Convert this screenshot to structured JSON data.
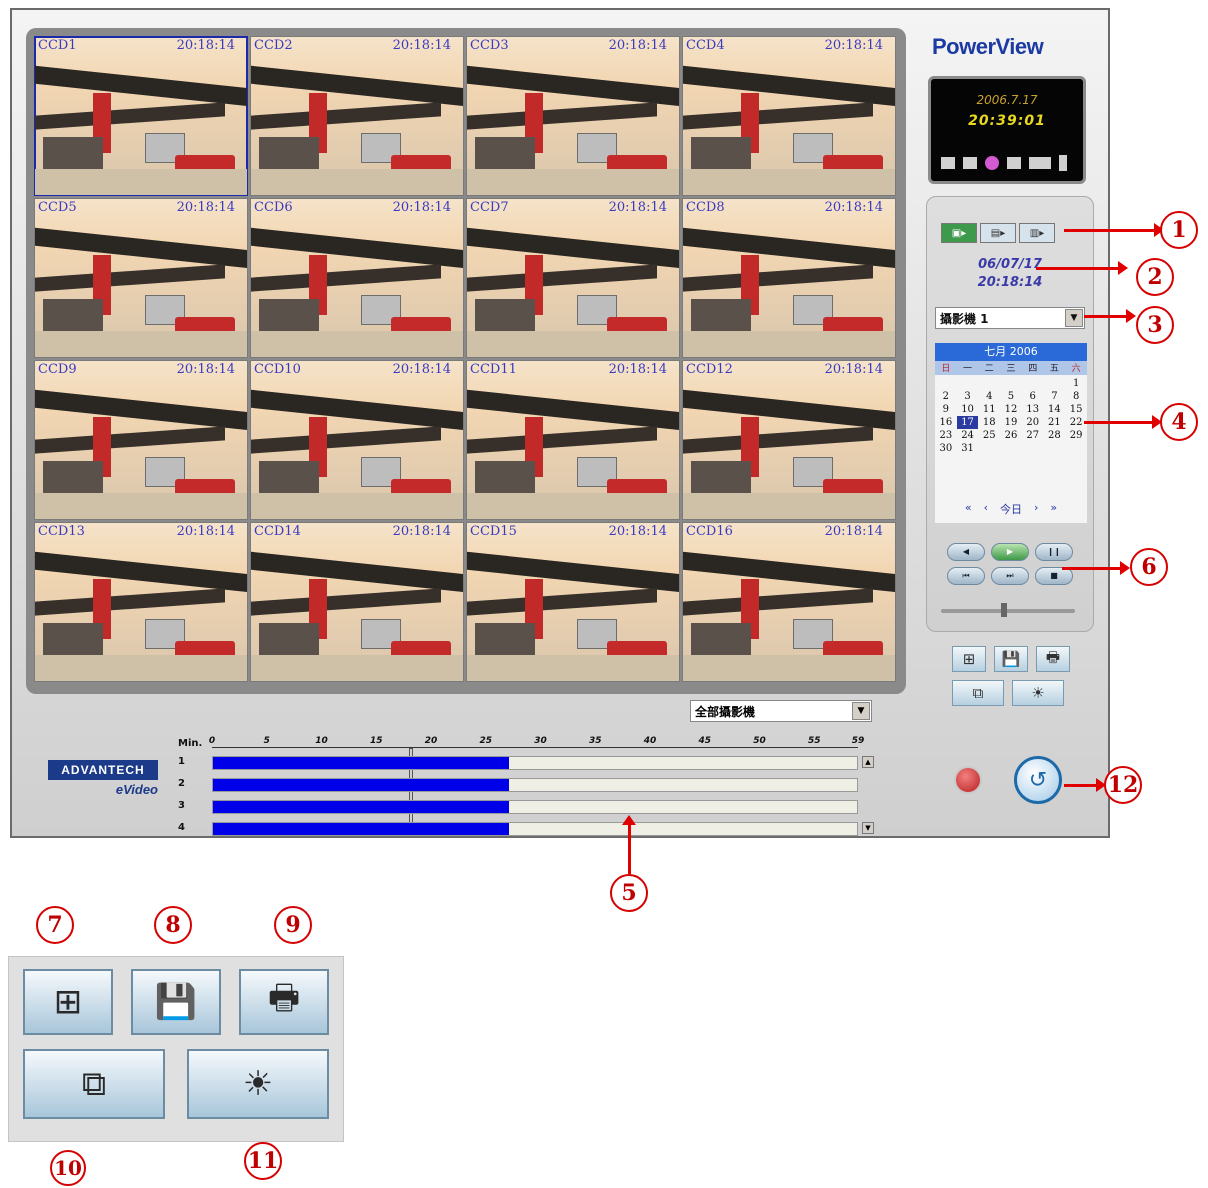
{
  "cameras": [
    {
      "label": "CCD1",
      "time": "20:18:14"
    },
    {
      "label": "CCD2",
      "time": "20:18:14"
    },
    {
      "label": "CCD3",
      "time": "20:18:14"
    },
    {
      "label": "CCD4",
      "time": "20:18:14"
    },
    {
      "label": "CCD5",
      "time": "20:18:14"
    },
    {
      "label": "CCD6",
      "time": "20:18:14"
    },
    {
      "label": "CCD7",
      "time": "20:18:14"
    },
    {
      "label": "CCD8",
      "time": "20:18:14"
    },
    {
      "label": "CCD9",
      "time": "20:18:14"
    },
    {
      "label": "CCD10",
      "time": "20:18:14"
    },
    {
      "label": "CCD11",
      "time": "20:18:14"
    },
    {
      "label": "CCD12",
      "time": "20:18:14"
    },
    {
      "label": "CCD13",
      "time": "20:18:14"
    },
    {
      "label": "CCD14",
      "time": "20:18:14"
    },
    {
      "label": "CCD15",
      "time": "20:18:14"
    },
    {
      "label": "CCD16",
      "time": "20:18:14"
    }
  ],
  "brand": {
    "name": "PowerView"
  },
  "clock": {
    "date": "2006.7.17",
    "time": "20:39:01"
  },
  "playback": {
    "date": "06/07/17",
    "time": "20:18:14"
  },
  "camera_select": {
    "value": "攝影機 1"
  },
  "calendar": {
    "month": "七月 2006",
    "weekdays": [
      "日",
      "一",
      "二",
      "三",
      "四",
      "五",
      "六"
    ],
    "days": [
      "",
      "",
      "",
      "",
      "",
      "",
      "1",
      "2",
      "3",
      "4",
      "5",
      "6",
      "7",
      "8",
      "9",
      "10",
      "11",
      "12",
      "13",
      "14",
      "15",
      "16",
      "17",
      "18",
      "19",
      "20",
      "21",
      "22",
      "23",
      "24",
      "25",
      "26",
      "27",
      "28",
      "29",
      "30",
      "31"
    ],
    "selected_day": "17",
    "nav": [
      "«",
      "‹",
      "今日",
      "›",
      "»"
    ]
  },
  "all_cameras_select": {
    "value": "全部攝影機"
  },
  "timeline": {
    "unit_label": "Min.",
    "ticks": [
      "0",
      "5",
      "10",
      "15",
      "20",
      "25",
      "30",
      "35",
      "40",
      "45",
      "50",
      "55",
      "59"
    ],
    "rows": [
      {
        "label": "1",
        "recorded_until_min": 27
      },
      {
        "label": "2",
        "recorded_until_min": 27
      },
      {
        "label": "3",
        "recorded_until_min": 27
      },
      {
        "label": "4",
        "recorded_until_min": 27
      }
    ],
    "cursor_min": 18
  },
  "logo": {
    "top": "ADVANTECH",
    "bottom": "eVideo"
  },
  "callouts": [
    "1",
    "2",
    "3",
    "4",
    "5",
    "6",
    "7",
    "8",
    "9",
    "10",
    "11",
    "12"
  ],
  "colors": {
    "accent": "#1c3aa4",
    "timeline_fill": "#0000e8",
    "callout": "#d60000"
  }
}
